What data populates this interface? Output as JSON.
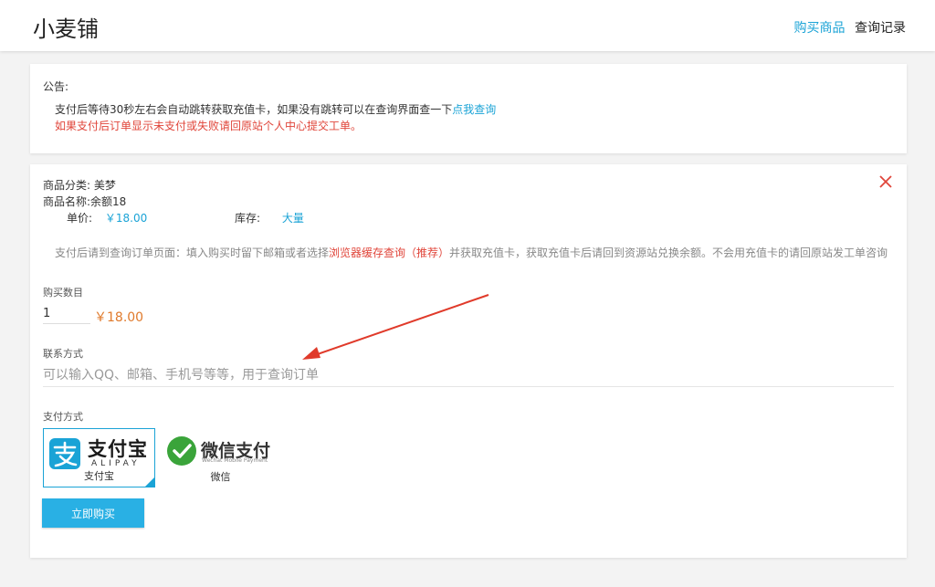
{
  "header": {
    "brand": "小麦铺",
    "nav": [
      {
        "label": "购买商品",
        "active": true
      },
      {
        "label": "查询记录",
        "active": false
      }
    ]
  },
  "notice": {
    "title": "公告:",
    "line1_text": "支付后等待30秒左右会自动跳转获取充值卡，如果没有跳转可以在查询界面查一下",
    "line1_link": "点我查询",
    "line2": "如果支付后订单显示未支付或失败请回原站个人中心提交工单。"
  },
  "order": {
    "category_label": "商品分类:",
    "category_value": "美梦",
    "name_label": "商品名称:",
    "name_value": "余额18",
    "price_label": "单价:",
    "price_value": "￥18.00",
    "stock_label": "库存:",
    "stock_value": "大量",
    "hint_before": "支付后请到查询订单页面：填入购买时留下邮箱或者选择",
    "hint_red": "浏览器缓存查询（推荐）",
    "hint_after": "并获取充值卡，获取充值卡后请回到资源站兑换余额。不会用充值卡的请回原站发工单咨询",
    "quantity_label": "购买数目",
    "quantity_value": "1",
    "total": "￥18.00",
    "contact_label": "联系方式",
    "contact_placeholder": "可以输入QQ、邮箱、手机号等等，用于查询订单",
    "payment_label": "支付方式",
    "payment_methods": [
      {
        "name": "支付宝",
        "logo_text": "支付宝",
        "logo_sub": "ALIPAY",
        "selected": true
      },
      {
        "name": "微信",
        "logo_text": "微信支付",
        "logo_sub": "Wechat Mobile Payment",
        "selected": false
      }
    ],
    "buy_button": "立即购买"
  },
  "colors": {
    "accent": "#1aa3d6",
    "button": "#29b0e4",
    "warning": "#e0453a",
    "price": "#e07a2c"
  }
}
